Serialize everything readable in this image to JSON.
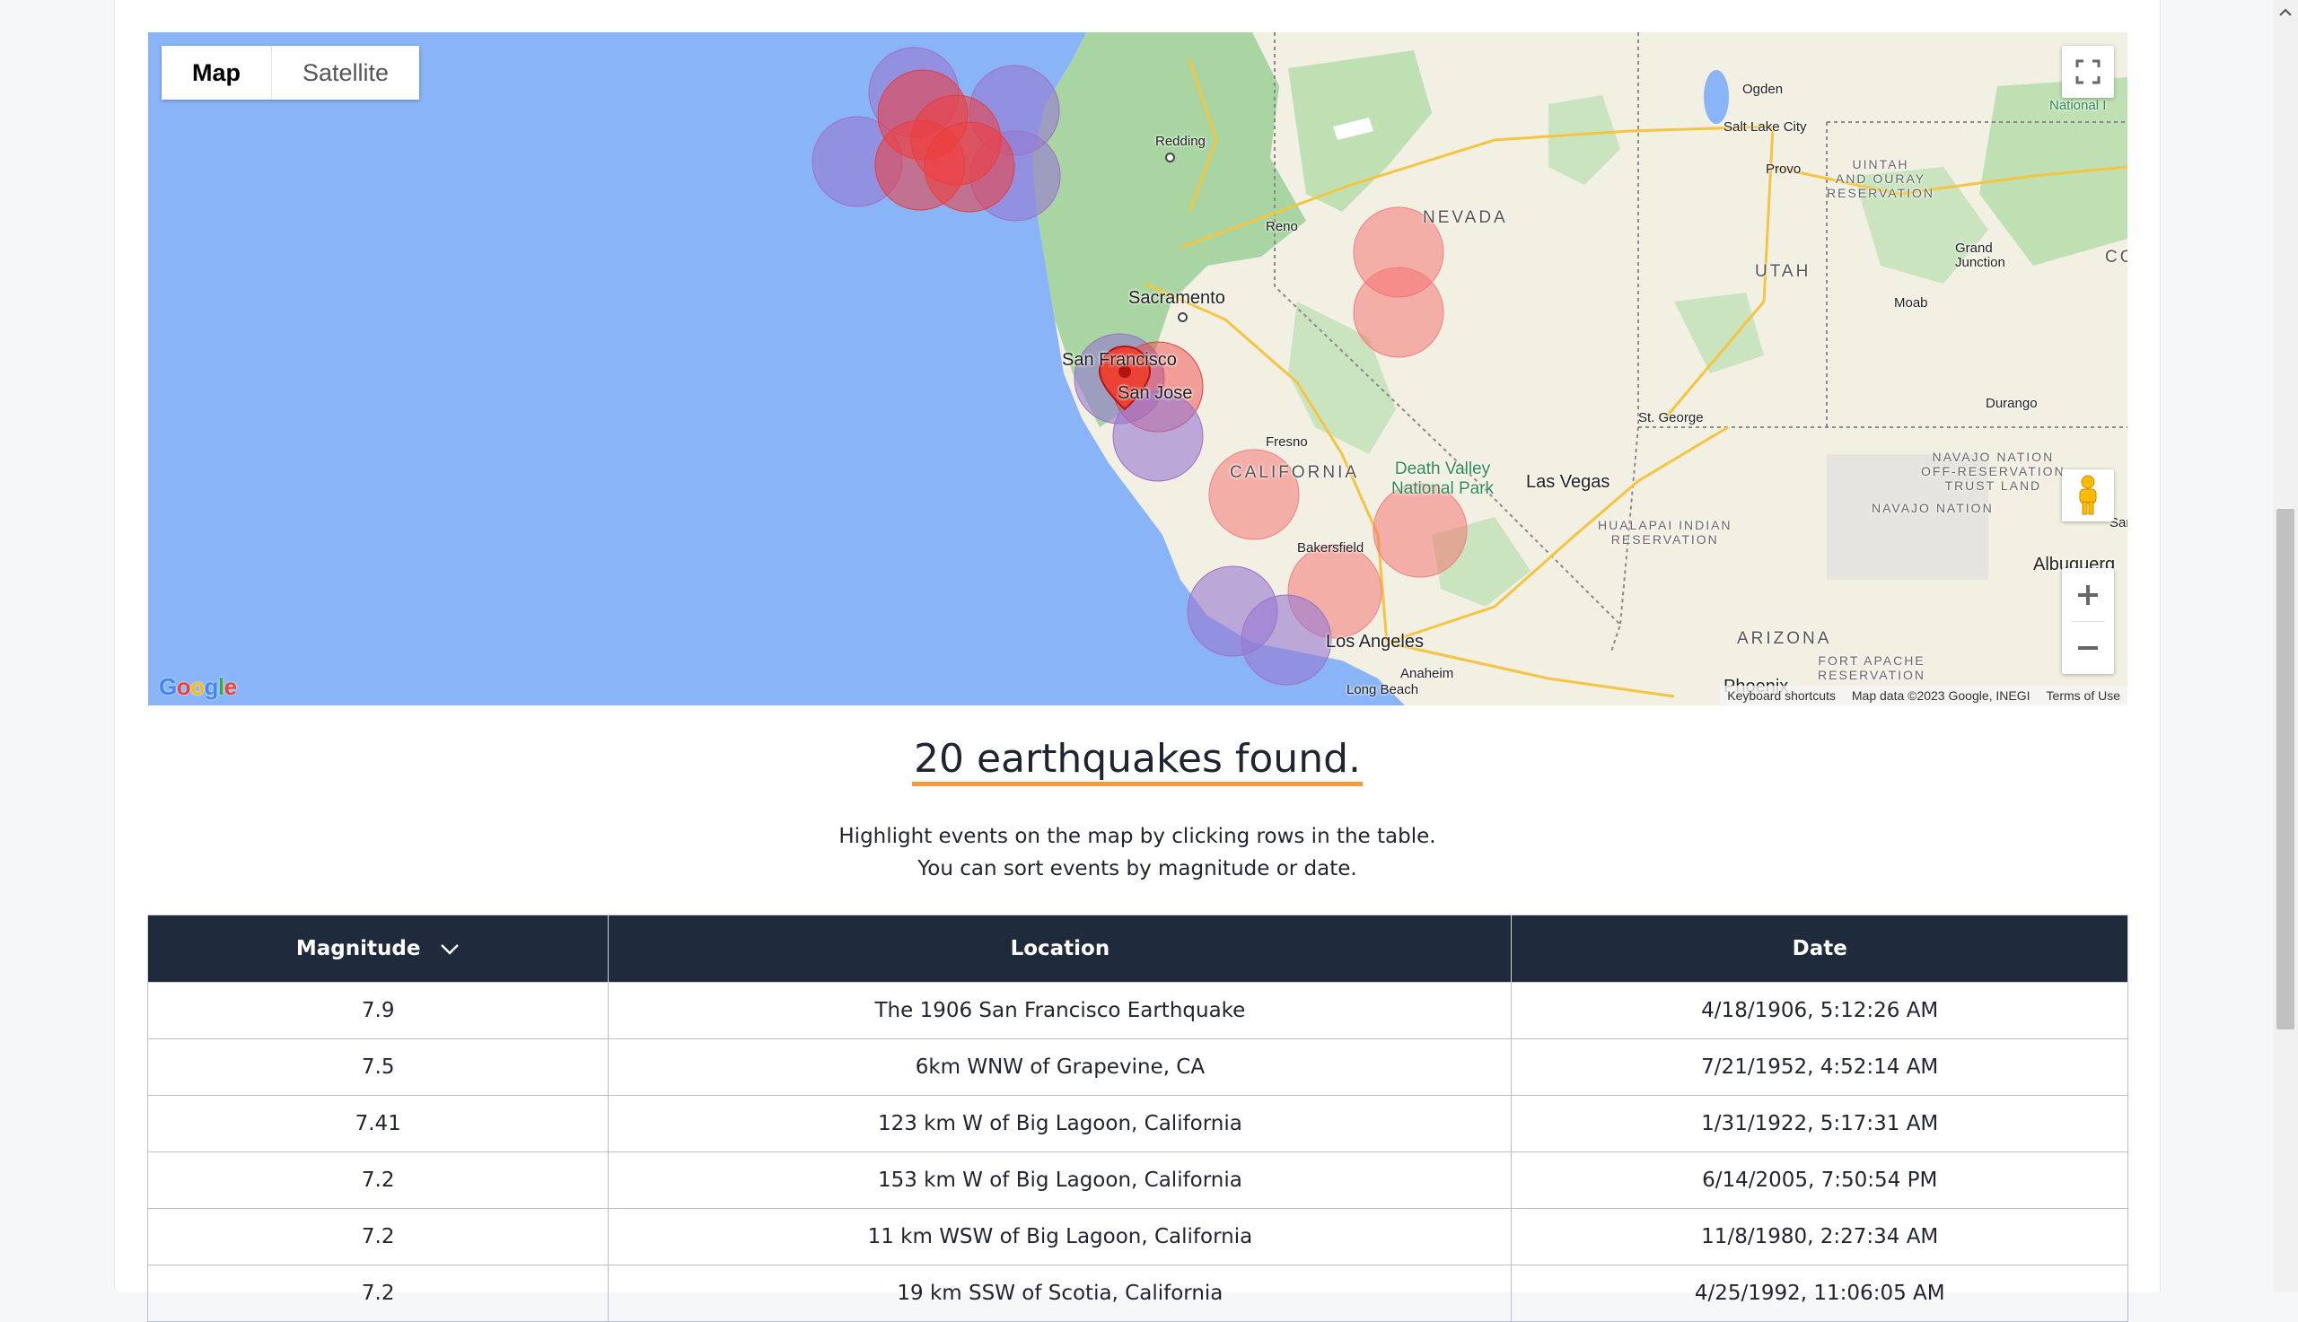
{
  "map": {
    "map_type_buttons": [
      "Map",
      "Satellite"
    ],
    "active_map_type": "Map",
    "google_logo": "Google",
    "attribution": {
      "keyboard_shortcuts": "Keyboard shortcuts",
      "map_data": "Map data ©2023 Google, INEGI",
      "terms": "Terms of Use"
    },
    "places": {
      "ogden": "Ogden",
      "salt_lake_city": "Salt Lake City",
      "provo": "Provo",
      "redding": "Redding",
      "reno": "Reno",
      "sacramento": "Sacramento",
      "san_francisco": "San Francisco",
      "san_jose": "San Jose",
      "fresno": "Fresno",
      "bakersfield": "Bakersfield",
      "los_angeles": "Los Angeles",
      "anaheim": "Anaheim",
      "long_beach": "Long Beach",
      "las_vegas": "Las Vegas",
      "st_george": "St. George",
      "moab": "Moab",
      "grand_junction": "Grand\nJunction",
      "durango": "Durango",
      "phoenix": "Phoenix",
      "albuquerque": "Albuquerq",
      "nevada": "NEVADA",
      "utah": "UTAH",
      "california": "CALIFORNIA",
      "arizona": "ARIZONA",
      "co_partial": "CO",
      "death_valley": "Death Valley\nNational Park",
      "uintah": "UINTAH\nAND OURAY\nRESERVATION",
      "hualapai": "HUALAPAI INDIAN\nRESERVATION",
      "navajo_trust": "NAVAJO NATION\nOFF-RESERVATION\nTRUST LAND",
      "navajo": "NAVAJO NATION",
      "fort_apache": "FORT APACHE\nRESERVATION",
      "national_partial": "National I",
      "sar_partial": "Sar"
    },
    "marker_label": "selected-event",
    "events": [
      {
        "lat": 41.5,
        "lon": -125.2,
        "mag": 7.41,
        "color": "purple"
      },
      {
        "lat": 41.3,
        "lon": -125.5,
        "mag": 7.2,
        "color": "purple"
      },
      {
        "lat": 41.4,
        "lon": -124.6,
        "mag": 7.2,
        "color": "red"
      },
      {
        "lat": 41.8,
        "lon": -124.3,
        "mag": 7.0,
        "color": "purple"
      }
    ]
  },
  "summary": {
    "headline": "20 earthquakes found.",
    "line1": "Highlight events on the map by clicking rows in the table.",
    "line2": "You can sort events by magnitude or date."
  },
  "table": {
    "headers": {
      "magnitude": "Magnitude",
      "location": "Location",
      "date": "Date"
    },
    "sort": {
      "column": "magnitude",
      "direction": "descending"
    },
    "rows": [
      {
        "magnitude": "7.9",
        "location": "The 1906 San Francisco Earthquake",
        "date": "4/18/1906, 5:12:26 AM"
      },
      {
        "magnitude": "7.5",
        "location": "6km WNW of Grapevine, CA",
        "date": "7/21/1952, 4:52:14 AM"
      },
      {
        "magnitude": "7.41",
        "location": "123 km W of Big Lagoon, California",
        "date": "1/31/1922, 5:17:31 AM"
      },
      {
        "magnitude": "7.2",
        "location": "153 km W of Big Lagoon, California",
        "date": "6/14/2005, 7:50:54 PM"
      },
      {
        "magnitude": "7.2",
        "location": "11 km WSW of Big Lagoon, California",
        "date": "11/8/1980, 2:27:34 AM"
      },
      {
        "magnitude": "7.2",
        "location": "19 km SSW of Scotia, California",
        "date": "4/25/1992, 11:06:05 AM"
      }
    ]
  }
}
